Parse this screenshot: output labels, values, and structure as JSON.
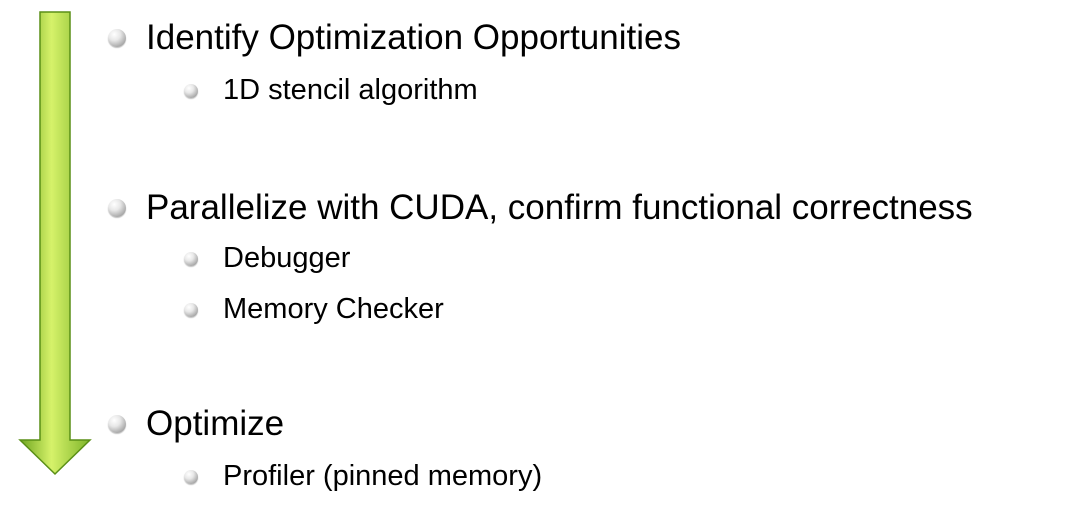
{
  "colors": {
    "arrow_light": "#d6f26a",
    "arrow_mid": "#8cc63e",
    "arrow_dark": "#5a8f16"
  },
  "icons": {
    "arrow": "down-arrow-icon",
    "bullet": "bullet-icon"
  },
  "steps": [
    {
      "text": "Identify Optimization Opportunities",
      "subitems": [
        "1D stencil algorithm"
      ]
    },
    {
      "text": "Parallelize with CUDA, confirm functional correctness",
      "subitems": [
        "Debugger",
        "Memory Checker"
      ]
    },
    {
      "text": "Optimize",
      "subitems": [
        "Profiler (pinned memory)"
      ]
    }
  ]
}
